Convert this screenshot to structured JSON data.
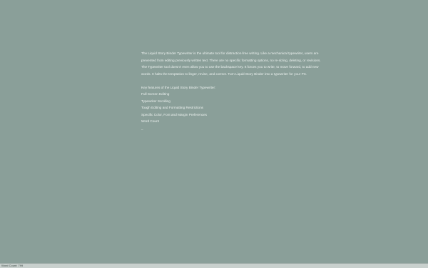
{
  "document": {
    "intro_lines": [
      "The Liquid Story Binder Typewriter is the ultimate tool for distraction-free writing.  Like a mechanical typewriter, users are",
      "prevented from editing previously written text.  There are no specific formatting options, no re-sizing, deleting, or revisions.",
      "The Typewriter tool doesn't even allow you to use the backspace key.  It forces you to write, to move forward, to add new",
      "words.  It halts the temptation to linger, revise, and correct.  Turn Liquid Story Binder into a typewriter for your PC."
    ],
    "features_heading": "Key features of the Liquid Story Binder Typewriter:",
    "features": [
      "Full Screen Editing",
      "Typewriter Scrolling",
      "Tough Editing and Formatting Restrictions",
      "Specific Color, Font and Margin Preferences",
      "Word Count"
    ],
    "caret": "_"
  },
  "status_bar": {
    "word_count": "Word Count: 799"
  },
  "colors": {
    "background": "#8a9f99",
    "text": "#eef3f1",
    "status_bar": "#c8d0cd"
  }
}
